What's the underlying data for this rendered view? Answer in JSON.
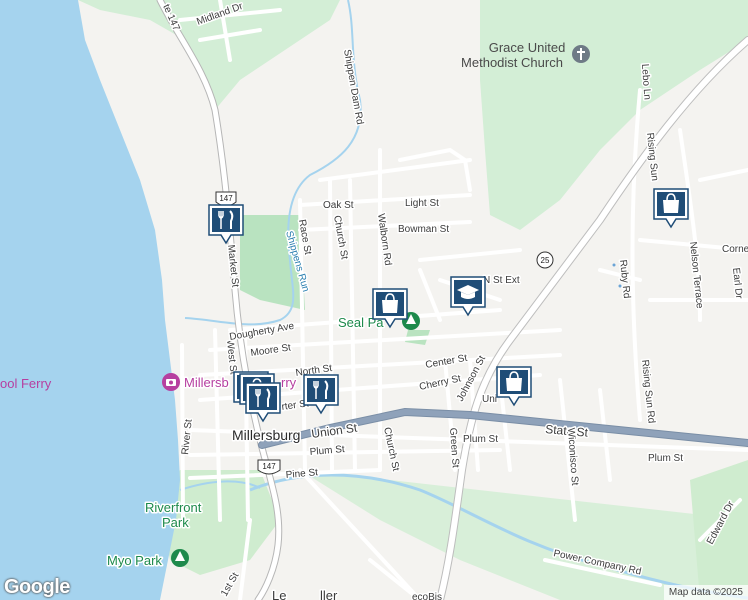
{
  "roads": {
    "state_st": "State St",
    "union_st": "Union St",
    "plum_st_w": "Plum St",
    "plum_st_mid": "Plum St",
    "plum_st_e": "Plum St",
    "pine_st": "Pine St",
    "market_st": "Market St",
    "west_st": "West St",
    "river_st": "River St",
    "race_st": "Race St",
    "church_st_n": "Church St",
    "church_st_s": "Church St",
    "walborn_rd": "Walborn Rd",
    "oak_st": "Oak St",
    "light_st": "Light St",
    "bowman_st": "Bowman St",
    "dougherty_ave": "Dougherty Ave",
    "moore_st": "Moore St",
    "north_st": "North St",
    "center_st": "Center St",
    "cherry_st": "Cherry St",
    "union_st_partial": "Uni",
    "carter_st_partial": "rter St",
    "n_st_ext": "N St Ext",
    "johnson_st": "Johnson St",
    "green_st": "Green St",
    "wiconisco_st": "Wiconisco St",
    "rising_sun_rd": "Rising Sun Rd",
    "rising_sun_partial": "Rising Sun",
    "ruby_rd": "Ruby Rd",
    "nelson_terrace": "Nelson Terrace",
    "earl_dr": "Earl Dr",
    "corner_partial": "Corne",
    "lebo_ln": "Lebo Ln",
    "midland_dr": "Midland Dr",
    "shippen_dam_rd": "Shippen Dam Rd",
    "power_company_rd": "Power Company Rd",
    "edward_dr": "Edward Dr",
    "first_st": "1st St",
    "route_147_label": "te 147",
    "bottom_partial_1": "Le",
    "bottom_partial_2": "ller",
    "bottom_partial_3": "ecoBis"
  },
  "water": {
    "shippens_run": "Shippens Run"
  },
  "shields": {
    "r147_north": "147",
    "r147_south": "147",
    "r25": "25"
  },
  "places": {
    "town": "Millersburg",
    "church": "Grace United Methodist Church",
    "church_line1": "Grace United",
    "church_line2": "Methodist Church",
    "seal_park": "Seal Pa",
    "ferry": "Millersb",
    "ferry_left": "ool Ferry",
    "ferry_suffix": "rry",
    "riverfront_park_1": "Riverfront",
    "riverfront_park_2": "Park",
    "myo_park": "Myo Park"
  },
  "markers": [
    {
      "id": "restaurant-1",
      "icon": "fork-knife-icon"
    },
    {
      "id": "shopping-1",
      "icon": "shopping-bag-icon"
    },
    {
      "id": "school-1",
      "icon": "graduation-cap-icon"
    },
    {
      "id": "restaurant-2",
      "icon": "fork-knife-icon"
    },
    {
      "id": "restaurant-3",
      "icon": "fork-knife-icon"
    },
    {
      "id": "shopping-2",
      "icon": "shopping-bag-icon"
    },
    {
      "id": "shopping-3",
      "icon": "shopping-bag-icon"
    }
  ],
  "colors": {
    "river": "#a5d3ee",
    "park": "#c9ebcf",
    "highway": "#8c9fb5",
    "marker_fill": "#1f4d77"
  },
  "attribution": {
    "logo": "Google",
    "data": "Map data ©2025"
  }
}
